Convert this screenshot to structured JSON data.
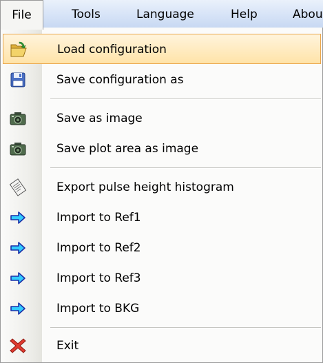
{
  "menubar": {
    "items": [
      {
        "label": "File"
      },
      {
        "label": "Tools"
      },
      {
        "label": "Language"
      },
      {
        "label": "Help"
      },
      {
        "label": "Abou"
      }
    ]
  },
  "file_menu": {
    "items": [
      {
        "label": "Load configuration",
        "icon": "open-folder-icon",
        "highlighted": true
      },
      {
        "label": "Save configuration as",
        "icon": "floppy-disk-icon"
      },
      {
        "label": "Save as image",
        "icon": "camera-icon"
      },
      {
        "label": "Save plot area as image",
        "icon": "camera-icon"
      },
      {
        "label": "Export pulse height histogram",
        "icon": "export-document-icon"
      },
      {
        "label": "Import to Ref1",
        "icon": "arrow-right-icon"
      },
      {
        "label": "Import to Ref2",
        "icon": "arrow-right-icon"
      },
      {
        "label": "Import to Ref3",
        "icon": "arrow-right-icon"
      },
      {
        "label": "Import to BKG",
        "icon": "arrow-right-icon"
      },
      {
        "label": "Exit",
        "icon": "close-icon"
      }
    ]
  },
  "colors": {
    "highlight_border": "#e9a54a",
    "highlight_fill": "#ffe3a8",
    "menubar_fill": "#d6e3f7",
    "arrow_fill": "#33ccff",
    "exit_red": "#e03a2f"
  }
}
